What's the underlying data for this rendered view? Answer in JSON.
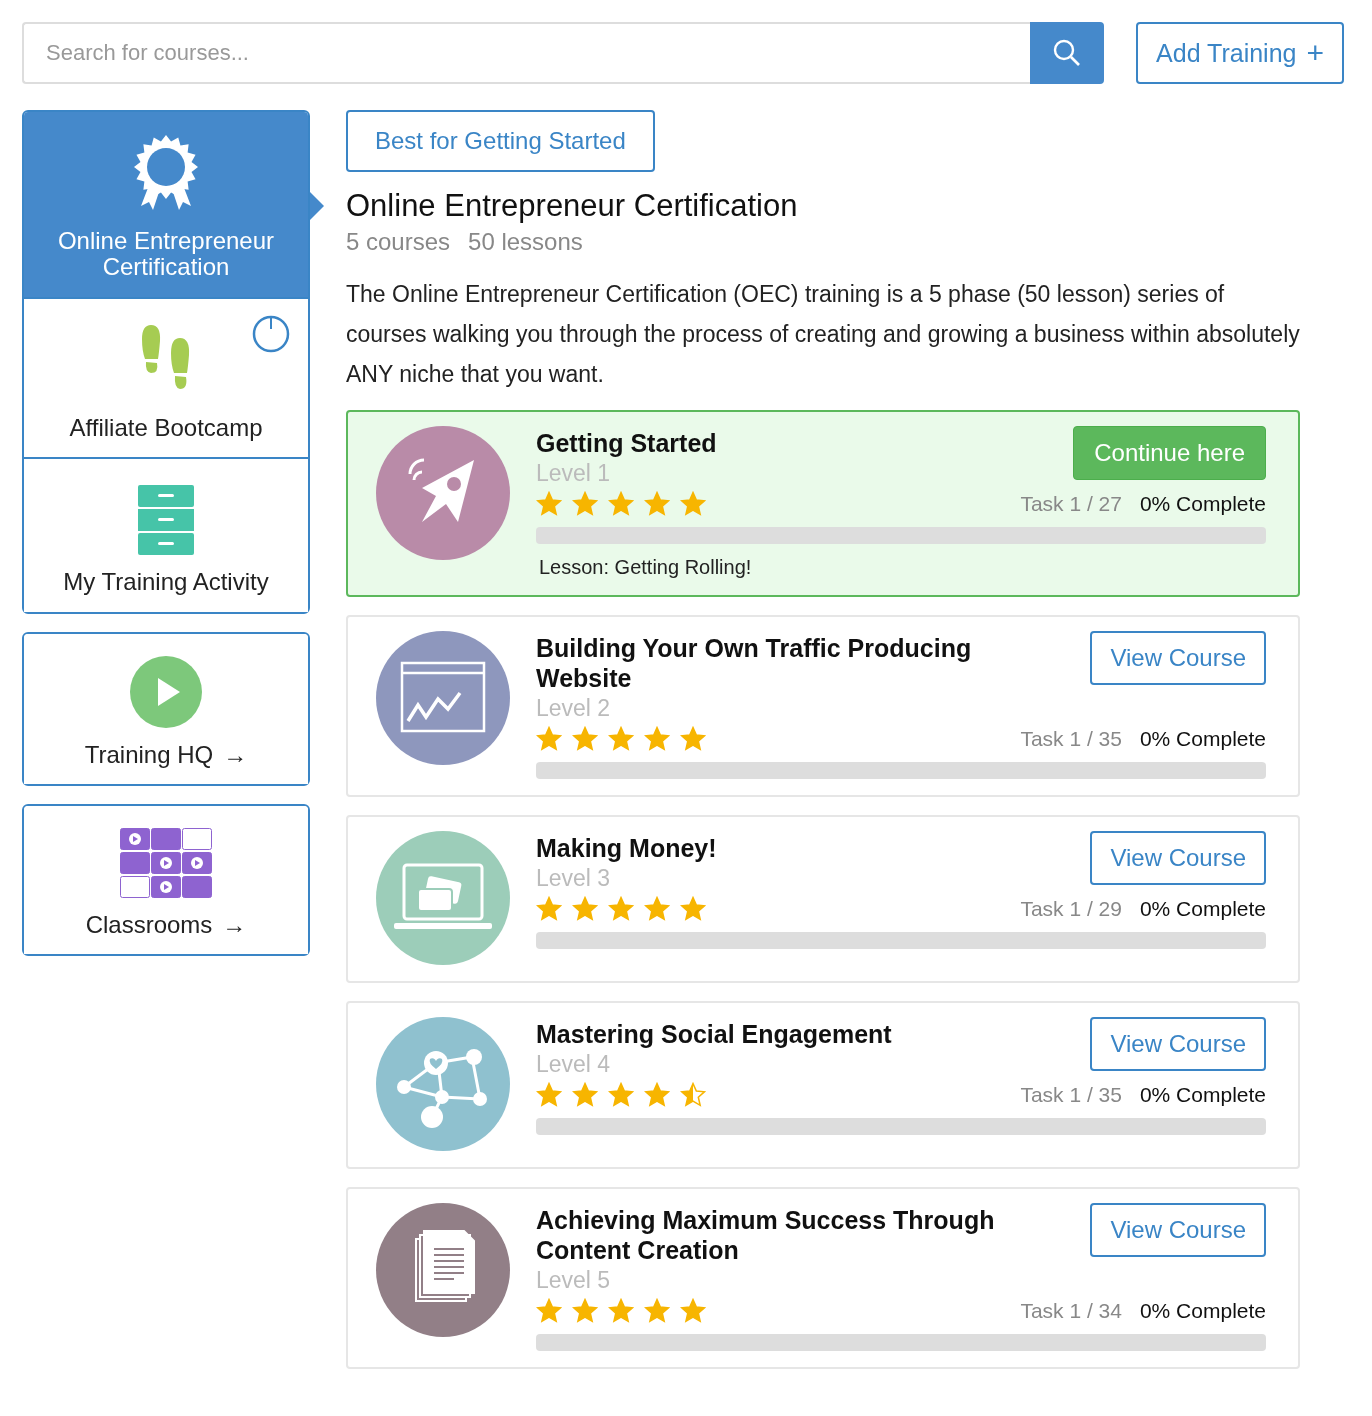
{
  "search": {
    "placeholder": "Search for courses..."
  },
  "add_button": {
    "label": "Add Training",
    "icon_text": "+"
  },
  "sidebar": {
    "groups": [
      {
        "items": [
          {
            "label": "Online Entrepreneur Certification",
            "selected": true,
            "in_progress": false
          },
          {
            "label": "Affiliate Bootcamp",
            "selected": false,
            "in_progress": true
          },
          {
            "label": "My Training Activity",
            "selected": false,
            "in_progress": false
          }
        ]
      },
      {
        "items": [
          {
            "label": "Training HQ",
            "arrow": "→",
            "selected": false,
            "in_progress": false
          }
        ]
      },
      {
        "items": [
          {
            "label": "Classrooms",
            "arrow": "→",
            "selected": false,
            "in_progress": false
          }
        ]
      }
    ]
  },
  "main": {
    "tag": "Best for Getting Started",
    "title": "Online Entrepreneur Certification",
    "stats": [
      "5 courses",
      "50 lessons"
    ],
    "description": "The Online Entrepreneur Certification (OEC) training is a 5 phase (50 lesson) series of courses walking you through the process of creating and growing a business within absolutely ANY niche that you want.",
    "courses": [
      {
        "color": "#b98ba8",
        "current": true,
        "title": "Getting Started",
        "level_text": "Level 1",
        "stars": 5,
        "task": "Task 1 / 27",
        "complete": "0% Complete",
        "level": 0,
        "button": "Continue here",
        "lesson": "Lesson: Getting Rolling!"
      },
      {
        "color": "#8e97bd",
        "current": false,
        "title": "Building Your Own Traffic Producing Website",
        "level_text": "Level 2",
        "stars": 5,
        "task": "Task 1 / 35",
        "complete": "0% Complete",
        "level": 0,
        "button": "View Course"
      },
      {
        "color": "#9ccdb9",
        "current": false,
        "title": "Making Money!",
        "level_text": "Level 3",
        "stars": 5,
        "task": "Task 1 / 29",
        "complete": "0% Complete",
        "level": 0,
        "button": "View Course"
      },
      {
        "color": "#8fc1cf",
        "current": false,
        "title": "Mastering Social Engagement",
        "level_text": "Level 4",
        "stars": 4.5,
        "task": "Task 1 / 35",
        "complete": "0% Complete",
        "level": 0,
        "button": "View Course"
      },
      {
        "color": "#927f87",
        "current": false,
        "title": "Achieving Maximum Success Through Content Creation",
        "level_text": "Level 5",
        "stars": 5,
        "task": "Task 1 / 34",
        "complete": "0% Complete",
        "level": 0,
        "button": "View Course"
      }
    ]
  }
}
